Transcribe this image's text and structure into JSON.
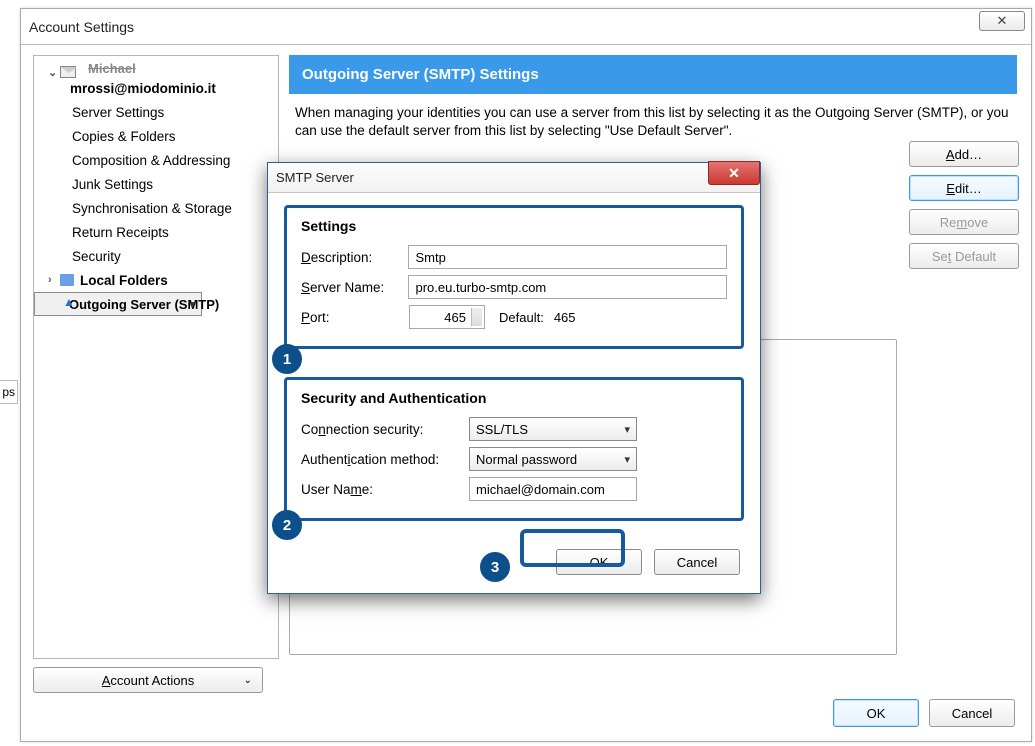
{
  "window": {
    "title": "Account Settings"
  },
  "tree": {
    "account_label_truncated": "Michael",
    "account_email": "mrossi@miodominio.it",
    "items": [
      "Server Settings",
      "Copies & Folders",
      "Composition & Addressing",
      "Junk Settings",
      "Synchronisation & Storage",
      "Return Receipts",
      "Security"
    ],
    "local_folders": "Local Folders",
    "outgoing": "Outgoing Server (SMTP)",
    "actions_label": "Account Actions"
  },
  "content": {
    "title": "Outgoing Server (SMTP) Settings",
    "description": "When managing your identities you can use a server from this list by selecting it as the Outgoing Server (SMTP), or you can use the default server from this list by selecting \"Use Default Server\".",
    "buttons": {
      "add": "Add…",
      "edit": "Edit…",
      "remove": "Remove",
      "set_default": "Set Default"
    }
  },
  "footer": {
    "ok": "OK",
    "cancel": "Cancel"
  },
  "modal": {
    "title": "SMTP Server",
    "settings_title": "Settings",
    "desc_label": "Description:",
    "desc_value": "Smtp",
    "server_label": "Server Name:",
    "server_value": "pro.eu.turbo-smtp.com",
    "port_label": "Port:",
    "port_value": "465",
    "default_label": "Default:",
    "default_value": "465",
    "sec_title": "Security and Authentication",
    "conn_label": "Connection security:",
    "conn_value": "SSL/TLS",
    "auth_label": "Authentication method:",
    "auth_value": "Normal password",
    "user_label": "User Name:",
    "user_value": "michael@domain.com",
    "ok": "OK",
    "cancel": "Cancel"
  },
  "annotations": {
    "a1": "1",
    "a2": "2",
    "a3": "3"
  },
  "sliver": "ps"
}
